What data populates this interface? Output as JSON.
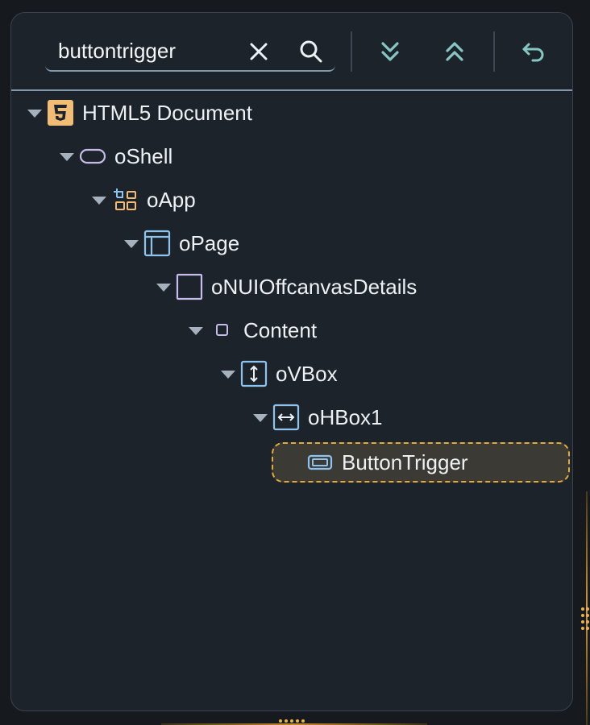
{
  "search": {
    "value": "buttontrigger",
    "placeholder": "Search"
  },
  "toolbar": {
    "clear_icon": "close-icon",
    "search_icon": "search-icon",
    "expand_all_icon": "double-chevron-down-icon",
    "collapse_all_icon": "double-chevron-up-icon",
    "undo_icon": "undo-icon"
  },
  "tree": {
    "nodes": [
      {
        "label": "HTML5 Document",
        "icon": "html5-icon",
        "expanded": true
      },
      {
        "label": "oShell",
        "icon": "shell-icon",
        "expanded": true
      },
      {
        "label": "oApp",
        "icon": "app-icon",
        "expanded": true
      },
      {
        "label": "oPage",
        "icon": "page-icon",
        "expanded": true
      },
      {
        "label": "oNUIOffcanvasDetails",
        "icon": "container-icon",
        "expanded": true
      },
      {
        "label": "Content",
        "icon": "aggregation-icon",
        "expanded": true
      },
      {
        "label": "oVBox",
        "icon": "vbox-icon",
        "expanded": true
      },
      {
        "label": "oHBox1",
        "icon": "hbox-icon",
        "expanded": true
      },
      {
        "label": "ButtonTrigger",
        "icon": "button-icon",
        "selected": true
      }
    ]
  },
  "colors": {
    "accent": "#e3ac3a",
    "panel": "#1d232a",
    "text": "#eef1f4",
    "icon_teal": "#86c7c3",
    "icon_blue": "#8fc3ef",
    "icon_purple": "#c8bbea"
  }
}
